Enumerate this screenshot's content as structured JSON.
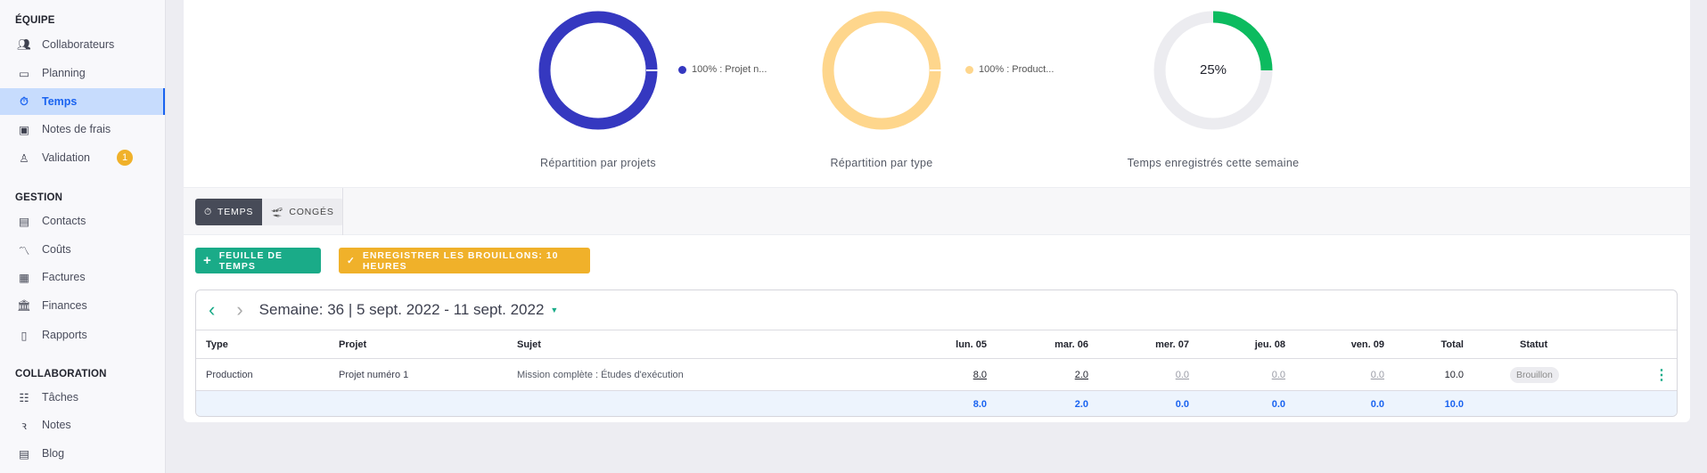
{
  "sidebar": {
    "sections": [
      {
        "title": "ÉQUIPE",
        "items": [
          {
            "label": "Collaborateurs",
            "icon": "people-icon"
          },
          {
            "label": "Planning",
            "icon": "calendar-icon"
          },
          {
            "label": "Temps",
            "icon": "stopwatch-icon",
            "active": true
          },
          {
            "label": "Notes de frais",
            "icon": "wallet-icon"
          },
          {
            "label": "Validation",
            "icon": "stamp-icon",
            "badge": "1"
          }
        ]
      },
      {
        "title": "GESTION",
        "items": [
          {
            "label": "Contacts",
            "icon": "contact-card-icon"
          },
          {
            "label": "Coûts",
            "icon": "trend-icon"
          },
          {
            "label": "Factures",
            "icon": "receipt-icon"
          },
          {
            "label": "Finances",
            "icon": "bank-icon"
          },
          {
            "label": "Rapports",
            "icon": "clipboard-icon"
          }
        ]
      },
      {
        "title": "COLLABORATION",
        "items": [
          {
            "label": "Tâches",
            "icon": "checklist-icon"
          },
          {
            "label": "Notes",
            "icon": "scribble-icon"
          },
          {
            "label": "Blog",
            "icon": "comment-list-icon"
          }
        ]
      }
    ]
  },
  "charts": [
    {
      "caption": "Répartition par projets",
      "legend": "100% : Projet n...",
      "value": 100,
      "color": "#3538c0"
    },
    {
      "caption": "Répartition par type",
      "legend": "100% : Product...",
      "value": 100,
      "color": "#fed68c"
    },
    {
      "caption": "Temps enregistrés cette semaine",
      "center": "25%",
      "value": 25,
      "color": "#0cbb5f",
      "track": "#ececf0"
    }
  ],
  "tabs": [
    {
      "label": "TEMPS",
      "icon": "stopwatch-icon",
      "active": true
    },
    {
      "label": "CONGÉS",
      "icon": "plane-departure-icon"
    }
  ],
  "actions": {
    "new_sheet": "FEUILLE DE TEMPS",
    "save_drafts": "ENREGISTRER LES BROUILLONS: 10 HEURES",
    "green": "#1aab88",
    "yellow": "#f0b12a"
  },
  "week": {
    "title": "Semaine: 36 | 5 sept. 2022 - 11 sept. 2022"
  },
  "table": {
    "headers": [
      "Type",
      "Projet",
      "Sujet",
      "lun. 05",
      "mar. 06",
      "mer. 07",
      "jeu. 08",
      "ven. 09",
      "Total",
      "Statut"
    ],
    "row": {
      "type": "Production",
      "projet": "Projet numéro 1",
      "sujet": "Mission complète : Études d'exécution",
      "days": [
        "8.0",
        "2.0",
        "0.0",
        "0.0",
        "0.0"
      ],
      "total": "10.0",
      "statut": "Brouillon"
    },
    "totals": [
      "8.0",
      "2.0",
      "0.0",
      "0.0",
      "0.0",
      "10.0"
    ]
  }
}
